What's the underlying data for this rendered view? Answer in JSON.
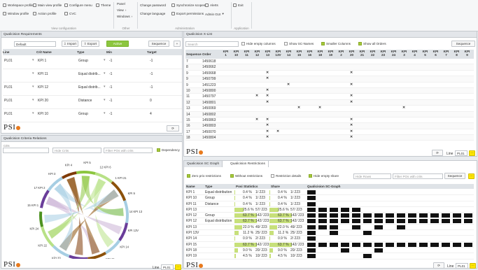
{
  "ribbon": {
    "col1": [
      "Workspace profile",
      "Window profile"
    ],
    "col2": [
      "Main view profile",
      "Action profile"
    ],
    "col3": [
      "Configure menu",
      "CVC"
    ],
    "col4": [
      "Theme"
    ],
    "group1_caption": "View configuration",
    "other": [
      "Panel",
      "View",
      "Windows"
    ],
    "other_caption": "Other",
    "admin1": [
      "Change password",
      "Change language"
    ],
    "admin2": [
      "Synchronize scopes",
      "Export permissions"
    ],
    "admin3": [
      "Alerts",
      "Admin GUI"
    ],
    "admin_caption": "Administration",
    "app": [
      "Exit"
    ],
    "app_caption": "Application"
  },
  "requirements": {
    "title": "Qualicision Requirements",
    "default": "Default",
    "import": "Import",
    "export": "Export",
    "active": "Active",
    "sequence": "Sequence",
    "headers": [
      "Line",
      "Crit Name",
      "Type",
      "Min",
      "Target"
    ],
    "rows": [
      [
        "PL01",
        "KPI 1",
        "Group",
        "-1",
        "-1"
      ],
      [
        "",
        "KPI 11",
        "Equal distrib...",
        "-1",
        "-1"
      ],
      [
        "PL01",
        "KPI 12",
        "Equal distrib...",
        "-1",
        "-1"
      ],
      [
        "PL01",
        "KPI 20",
        "Distance",
        "-1",
        "0"
      ],
      [
        "PL01",
        "KPI 10",
        "Group",
        "-1",
        "4"
      ]
    ]
  },
  "xlist": {
    "title": "Qualicision X-List",
    "search_placeholder": "Search",
    "checks": [
      "Hide empty columns",
      "Show SC-Names",
      "Smaller Columns",
      "Show all Orders"
    ],
    "sequence": "Sequence",
    "col_seq": "Sequence",
    "col_order": "Order",
    "kpi_cols": [
      "1",
      "10",
      "11",
      "12",
      "13",
      "13V",
      "14",
      "15",
      "16",
      "18",
      "19",
      "2",
      "20",
      "21",
      "22",
      "23",
      "24",
      "3",
      "4",
      "5",
      "6",
      "7",
      "8",
      "9"
    ],
    "rows": [
      {
        "seq": "7",
        "order": "1450618"
      },
      {
        "seq": "8",
        "order": "1450662"
      },
      {
        "seq": "9",
        "order": "1450668"
      },
      {
        "seq": "9",
        "order": "1450799"
      },
      {
        "seq": "9",
        "order": "1451223"
      },
      {
        "seq": "10",
        "order": "1450800"
      },
      {
        "seq": "11",
        "order": "1450797"
      },
      {
        "seq": "12",
        "order": "1450801"
      },
      {
        "seq": "13",
        "order": "1450069"
      },
      {
        "seq": "14",
        "order": "1450802"
      },
      {
        "seq": "15",
        "order": "1450863"
      },
      {
        "seq": "16",
        "order": "1450803"
      },
      {
        "seq": "17",
        "order": "1450070"
      },
      {
        "seq": "18",
        "order": "1450804"
      }
    ],
    "line_label": "Line",
    "line_value": "PL01"
  },
  "relations": {
    "title": "Qualicision Criteria Relations",
    "c1_label": "Crits",
    "c2_placeholder": "Hide Crits",
    "c3_placeholder": "Filter POs with crits",
    "dependency": "Dependency",
    "labels": [
      "15 KPI 1\n15 | 1",
      "17 KPI 2\n17 | 2",
      "KPI 3",
      "KPI 4",
      "KPI 5\n11 | 5",
      "12 KPI 6\n12 | 6",
      "1 KPI 21\n1 | 21",
      "KPI 9",
      "14 KPI 13\n14 | 13",
      "KPI 13V",
      "KPI 14",
      "KPI 15\n15 | 12",
      "KPI 10",
      "KPI 11",
      "KPI 20",
      "KPI 22",
      "KPI 24"
    ],
    "line_label": "Line",
    "line_value": "PL01"
  },
  "restrictions": {
    "tab1": "Qualicision SC Graph",
    "tab2": "Qualicision Restrictions",
    "checks": [
      "Zero prio restrictions",
      "Without restrictions",
      "Restriction details",
      "Hide empty share"
    ],
    "hide_rows_placeholder": "Hide Rows",
    "filter_placeholder": "Filter POs with crits",
    "sequence": "Sequence",
    "headers": [
      "Name",
      "Type",
      "Posi Statistics",
      "Share",
      "Qualicision SC-Graph"
    ],
    "rows": [
      [
        "KPI 1",
        "Equal distribution",
        "0.4 %",
        "1/ 223",
        "0.4 %",
        "1/ 223"
      ],
      [
        "KPI 10",
        "Group",
        "0.4 %",
        "1/ 223",
        "0.4 %",
        "1/ 223"
      ],
      [
        "KPI 11",
        "Distance",
        "0.4 %",
        "1/ 223",
        "0.4 %",
        "1/ 223"
      ],
      [
        "KPI 13",
        "",
        "25.6 %",
        "57/ 223",
        "25.6 %",
        "57/ 223"
      ],
      [
        "KPI 12",
        "Group",
        "63.7 %",
        "142/ 223",
        "63.7 %",
        "142/ 223"
      ],
      [
        "KPI 12",
        "Equal distribution",
        "63.7 %",
        "142/ 223",
        "63.7 %",
        "142/ 223"
      ],
      [
        "KPI 13",
        "",
        "22.0 %",
        "49/ 223",
        "22.0 %",
        "49/ 223"
      ],
      [
        "KPI 13V",
        "",
        "11.2 %",
        "25/ 223",
        "11.2 %",
        "25/ 223"
      ],
      [
        "KPI 14",
        "",
        "0.9 %",
        "2/ 223",
        "0.9 %",
        "2/ 223"
      ],
      [
        "KPI 15",
        "",
        "63.7 %",
        "142/ 223",
        "63.7 %",
        "142/ 223"
      ],
      [
        "KPI 18",
        "",
        "9.0 %",
        "20/ 223",
        "9.0 %",
        "20/ 223"
      ],
      [
        "KPI 19",
        "",
        "4.5 %",
        "10/ 223",
        "4.5 %",
        "10/ 223"
      ]
    ],
    "line_label": "Line",
    "line_value": "PL01"
  },
  "brand": "PSI",
  "colors": {
    "accent": "#8cc63f",
    "highlight": "#ffe600",
    "brand_dot": "#e87a1d"
  }
}
